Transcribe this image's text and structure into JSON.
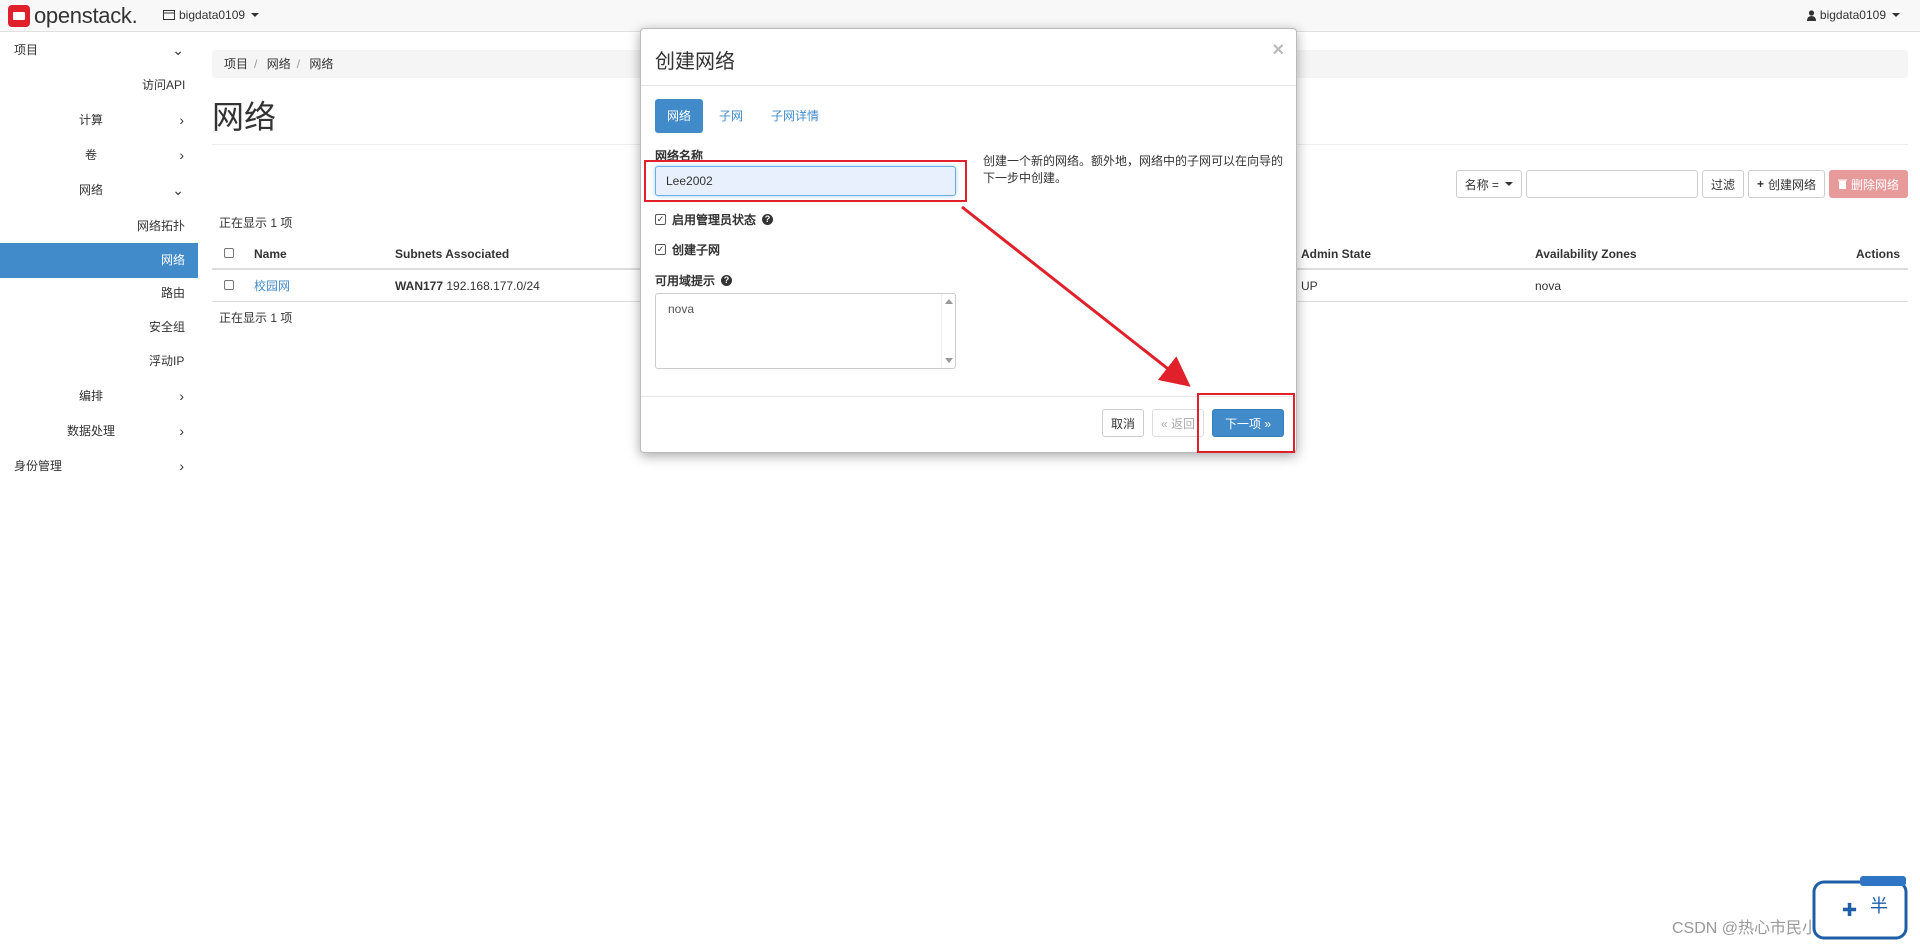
{
  "navbar": {
    "logo_text": "openstack.",
    "project": "bigdata0109",
    "user": "bigdata0109"
  },
  "sidebar": {
    "items": [
      {
        "label": "项目"
      },
      {
        "label": "访问API"
      },
      {
        "label": "计算"
      },
      {
        "label": "卷"
      },
      {
        "label": "网络"
      },
      {
        "label": "网络拓扑"
      },
      {
        "label": "网络"
      },
      {
        "label": "路由"
      },
      {
        "label": "安全组"
      },
      {
        "label": "浮动IP"
      },
      {
        "label": "编排"
      },
      {
        "label": "数据处理"
      },
      {
        "label": "身份管理"
      }
    ]
  },
  "breadcrumb": [
    "项目",
    "网络",
    "网络"
  ],
  "page_title": "网络",
  "actions": {
    "filter_field": "名称 =",
    "filter_button": "过滤",
    "create_button": "创建网络",
    "delete_button": "删除网络"
  },
  "table": {
    "count_text": "正在显示 1 项",
    "headers": [
      "Name",
      "Subnets Associated",
      "Admin State",
      "Availability Zones",
      "Actions"
    ],
    "rows": [
      {
        "name": "校园网",
        "subnet_name": "WAN177",
        "subnet_cidr": "192.168.177.0/24",
        "admin_state": "UP",
        "az": "nova"
      }
    ]
  },
  "modal": {
    "title": "创建网络",
    "close": "×",
    "tabs": [
      "网络",
      "子网",
      "子网详情"
    ],
    "network_name_label": "网络名称",
    "network_name_value": "Lee2002",
    "admin_state_label": "启用管理员状态",
    "create_subnet_label": "创建子网",
    "az_hint_label": "可用域提示",
    "az_option": "nova",
    "help_text": "创建一个新的网络。额外地，网络中的子网可以在向导的下一步中创建。",
    "cancel": "取消",
    "back": "« 返回",
    "next": "下一项 »"
  },
  "watermark": "CSDN @热心市民小李同学",
  "colors": {
    "primary": "#428bca",
    "danger_light": "#e79a9a",
    "annotation_red": "#e0202a"
  }
}
